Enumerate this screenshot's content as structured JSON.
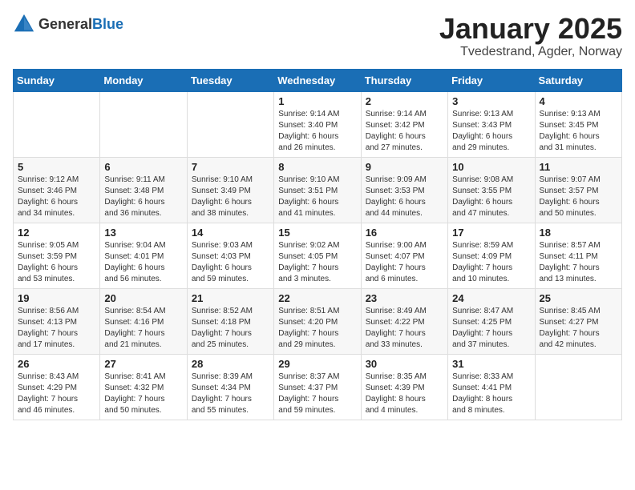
{
  "header": {
    "logo_general": "General",
    "logo_blue": "Blue",
    "month": "January 2025",
    "location": "Tvedestrand, Agder, Norway"
  },
  "days_of_week": [
    "Sunday",
    "Monday",
    "Tuesday",
    "Wednesday",
    "Thursday",
    "Friday",
    "Saturday"
  ],
  "weeks": [
    [
      {
        "day": "",
        "info": ""
      },
      {
        "day": "",
        "info": ""
      },
      {
        "day": "",
        "info": ""
      },
      {
        "day": "1",
        "info": "Sunrise: 9:14 AM\nSunset: 3:40 PM\nDaylight: 6 hours\nand 26 minutes."
      },
      {
        "day": "2",
        "info": "Sunrise: 9:14 AM\nSunset: 3:42 PM\nDaylight: 6 hours\nand 27 minutes."
      },
      {
        "day": "3",
        "info": "Sunrise: 9:13 AM\nSunset: 3:43 PM\nDaylight: 6 hours\nand 29 minutes."
      },
      {
        "day": "4",
        "info": "Sunrise: 9:13 AM\nSunset: 3:45 PM\nDaylight: 6 hours\nand 31 minutes."
      }
    ],
    [
      {
        "day": "5",
        "info": "Sunrise: 9:12 AM\nSunset: 3:46 PM\nDaylight: 6 hours\nand 34 minutes."
      },
      {
        "day": "6",
        "info": "Sunrise: 9:11 AM\nSunset: 3:48 PM\nDaylight: 6 hours\nand 36 minutes."
      },
      {
        "day": "7",
        "info": "Sunrise: 9:10 AM\nSunset: 3:49 PM\nDaylight: 6 hours\nand 38 minutes."
      },
      {
        "day": "8",
        "info": "Sunrise: 9:10 AM\nSunset: 3:51 PM\nDaylight: 6 hours\nand 41 minutes."
      },
      {
        "day": "9",
        "info": "Sunrise: 9:09 AM\nSunset: 3:53 PM\nDaylight: 6 hours\nand 44 minutes."
      },
      {
        "day": "10",
        "info": "Sunrise: 9:08 AM\nSunset: 3:55 PM\nDaylight: 6 hours\nand 47 minutes."
      },
      {
        "day": "11",
        "info": "Sunrise: 9:07 AM\nSunset: 3:57 PM\nDaylight: 6 hours\nand 50 minutes."
      }
    ],
    [
      {
        "day": "12",
        "info": "Sunrise: 9:05 AM\nSunset: 3:59 PM\nDaylight: 6 hours\nand 53 minutes."
      },
      {
        "day": "13",
        "info": "Sunrise: 9:04 AM\nSunset: 4:01 PM\nDaylight: 6 hours\nand 56 minutes."
      },
      {
        "day": "14",
        "info": "Sunrise: 9:03 AM\nSunset: 4:03 PM\nDaylight: 6 hours\nand 59 minutes."
      },
      {
        "day": "15",
        "info": "Sunrise: 9:02 AM\nSunset: 4:05 PM\nDaylight: 7 hours\nand 3 minutes."
      },
      {
        "day": "16",
        "info": "Sunrise: 9:00 AM\nSunset: 4:07 PM\nDaylight: 7 hours\nand 6 minutes."
      },
      {
        "day": "17",
        "info": "Sunrise: 8:59 AM\nSunset: 4:09 PM\nDaylight: 7 hours\nand 10 minutes."
      },
      {
        "day": "18",
        "info": "Sunrise: 8:57 AM\nSunset: 4:11 PM\nDaylight: 7 hours\nand 13 minutes."
      }
    ],
    [
      {
        "day": "19",
        "info": "Sunrise: 8:56 AM\nSunset: 4:13 PM\nDaylight: 7 hours\nand 17 minutes."
      },
      {
        "day": "20",
        "info": "Sunrise: 8:54 AM\nSunset: 4:16 PM\nDaylight: 7 hours\nand 21 minutes."
      },
      {
        "day": "21",
        "info": "Sunrise: 8:52 AM\nSunset: 4:18 PM\nDaylight: 7 hours\nand 25 minutes."
      },
      {
        "day": "22",
        "info": "Sunrise: 8:51 AM\nSunset: 4:20 PM\nDaylight: 7 hours\nand 29 minutes."
      },
      {
        "day": "23",
        "info": "Sunrise: 8:49 AM\nSunset: 4:22 PM\nDaylight: 7 hours\nand 33 minutes."
      },
      {
        "day": "24",
        "info": "Sunrise: 8:47 AM\nSunset: 4:25 PM\nDaylight: 7 hours\nand 37 minutes."
      },
      {
        "day": "25",
        "info": "Sunrise: 8:45 AM\nSunset: 4:27 PM\nDaylight: 7 hours\nand 42 minutes."
      }
    ],
    [
      {
        "day": "26",
        "info": "Sunrise: 8:43 AM\nSunset: 4:29 PM\nDaylight: 7 hours\nand 46 minutes."
      },
      {
        "day": "27",
        "info": "Sunrise: 8:41 AM\nSunset: 4:32 PM\nDaylight: 7 hours\nand 50 minutes."
      },
      {
        "day": "28",
        "info": "Sunrise: 8:39 AM\nSunset: 4:34 PM\nDaylight: 7 hours\nand 55 minutes."
      },
      {
        "day": "29",
        "info": "Sunrise: 8:37 AM\nSunset: 4:37 PM\nDaylight: 7 hours\nand 59 minutes."
      },
      {
        "day": "30",
        "info": "Sunrise: 8:35 AM\nSunset: 4:39 PM\nDaylight: 8 hours\nand 4 minutes."
      },
      {
        "day": "31",
        "info": "Sunrise: 8:33 AM\nSunset: 4:41 PM\nDaylight: 8 hours\nand 8 minutes."
      },
      {
        "day": "",
        "info": ""
      }
    ]
  ]
}
